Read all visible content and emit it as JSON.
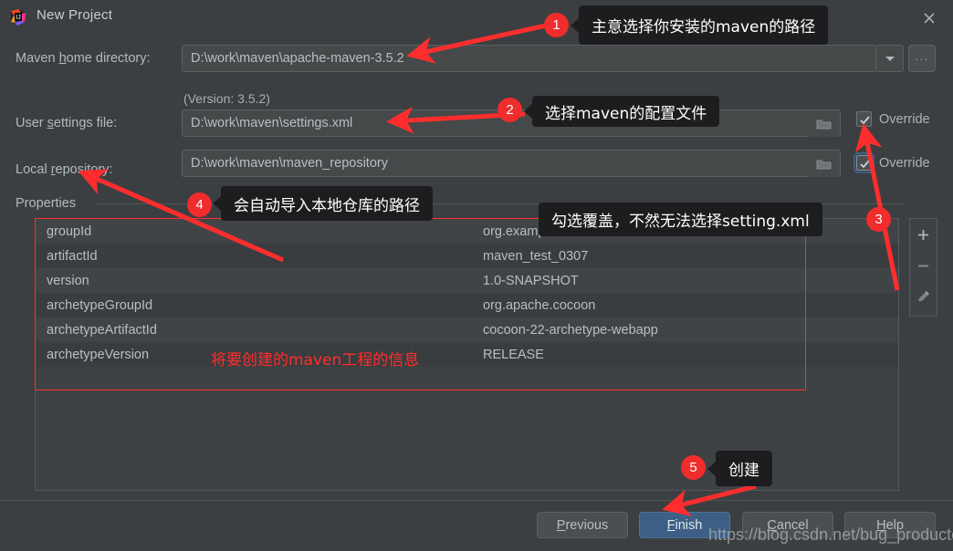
{
  "window": {
    "title": "New Project",
    "app_icon": "intellij-idea-icon",
    "close_icon": "close-icon"
  },
  "form": {
    "maven_home": {
      "label_pre": "Maven ",
      "label_mnemonic": "h",
      "label_post": "ome directory:",
      "value": "D:\\work\\maven\\apache-maven-3.5.2",
      "dropdown_icon": "chevron-down-icon",
      "browse_label": "..."
    },
    "version_note": "(Version: 3.5.2)",
    "user_settings": {
      "label_pre": "User ",
      "label_mnemonic": "s",
      "label_post": "ettings file:",
      "value": "D:\\work\\maven\\settings.xml",
      "folder_icon": "folder-icon",
      "override_label": "Override",
      "override_checked": true
    },
    "local_repository": {
      "label_pre": "Local ",
      "label_mnemonic": "r",
      "label_post": "epository:",
      "value": "D:\\work\\maven\\maven_repository",
      "folder_icon": "folder-icon",
      "override_label": "Override",
      "override_checked": true
    }
  },
  "properties": {
    "section_label": "Properties",
    "rows": [
      {
        "key": "groupId",
        "value": "org.example"
      },
      {
        "key": "artifactId",
        "value": "maven_test_0307"
      },
      {
        "key": "version",
        "value": "1.0-SNAPSHOT"
      },
      {
        "key": "archetypeGroupId",
        "value": "org.apache.cocoon"
      },
      {
        "key": "archetypeArtifactId",
        "value": "cocoon-22-archetype-webapp"
      },
      {
        "key": "archetypeVersion",
        "value": "RELEASE"
      }
    ],
    "tools": [
      {
        "name": "add-property-button",
        "glyph": "+"
      },
      {
        "name": "remove-property-button",
        "glyph": "−"
      },
      {
        "name": "edit-property-button",
        "glyph": "pencil-icon"
      }
    ]
  },
  "buttons": {
    "previous": {
      "pre": "",
      "mnemonic": "P",
      "post": "revious"
    },
    "finish": {
      "pre": "",
      "mnemonic": "F",
      "post": "inish"
    },
    "cancel": {
      "pre": "",
      "mnemonic": "C",
      "post": "ancel"
    },
    "help": {
      "pre": "",
      "mnemonic": "H",
      "post": "elp"
    }
  },
  "annotations": {
    "callout1": {
      "badge": "1",
      "text": "主意选择你安装的maven的路径"
    },
    "callout2": {
      "badge": "2",
      "text": "选择maven的配置文件"
    },
    "callout3": {
      "badge": "3",
      "text": "勾选覆盖，不然无法选择setting.xml"
    },
    "callout4": {
      "badge": "4",
      "text": "会自动导入本地仓库的路径"
    },
    "callout5": {
      "badge": "5",
      "text": "创建"
    },
    "table_note": "将要创建的maven工程的信息",
    "accent_color": "#ff2d2d"
  },
  "watermark": "https://blog.csdn.net/bug_producter"
}
